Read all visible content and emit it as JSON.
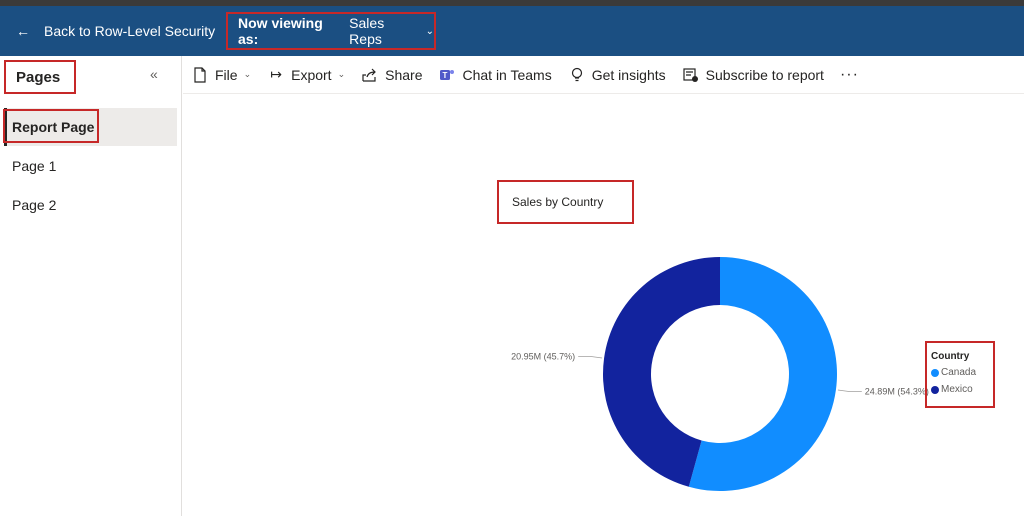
{
  "header": {
    "back_label": "Back to Row-Level Security",
    "viewing_prefix": "Now viewing as:",
    "viewing_role": "Sales Reps"
  },
  "sidebar": {
    "title": "Pages",
    "items": [
      {
        "label": "Report Page",
        "active": true
      },
      {
        "label": "Page 1",
        "active": false
      },
      {
        "label": "Page 2",
        "active": false
      }
    ]
  },
  "toolbar": {
    "file": "File",
    "export": "Export",
    "share": "Share",
    "chat": "Chat in Teams",
    "insights": "Get insights",
    "subscribe": "Subscribe to report",
    "more": "···"
  },
  "colors": {
    "header_bg": "#1b4f82",
    "highlight": "#c62828",
    "canada": "#118dff",
    "mexico": "#12239e"
  },
  "chart_data": {
    "type": "pie",
    "title": "Sales by Country",
    "legend_title": "Country",
    "legend_placement": "right",
    "series": [
      {
        "name": "Canada",
        "value": 24.89,
        "label": "24.89M (54.3%)"
      },
      {
        "name": "Mexico",
        "value": 20.95,
        "label": "20.95M (45.7%)"
      }
    ]
  }
}
